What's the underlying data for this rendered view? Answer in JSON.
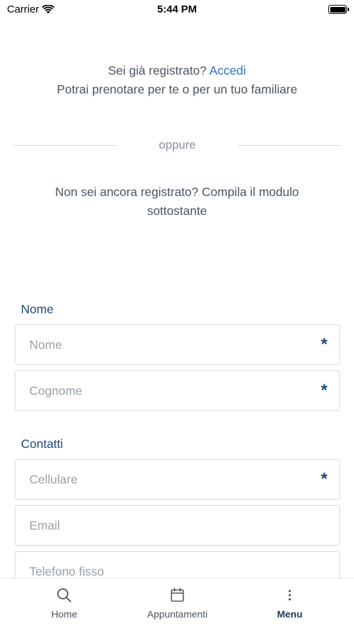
{
  "status_bar": {
    "carrier": "Carrier",
    "time": "5:44 PM"
  },
  "intro": {
    "already_registered": "Sei già registrato?",
    "login_link": "Accedi",
    "subtitle": "Potrai prenotare per te o per un tuo familiare"
  },
  "divider": {
    "text": "oppure"
  },
  "register_prompt": "Non sei ancora registrato? Compila il modulo sottostante",
  "form": {
    "name_section": {
      "title": "Nome",
      "fields": [
        {
          "placeholder": "Nome",
          "required": "*"
        },
        {
          "placeholder": "Cognome",
          "required": "*"
        }
      ]
    },
    "contacts_section": {
      "title": "Contatti",
      "fields": [
        {
          "placeholder": "Cellulare",
          "required": "*"
        },
        {
          "placeholder": "Email"
        },
        {
          "placeholder": "Telefono fisso"
        }
      ]
    }
  },
  "tab_bar": {
    "items": [
      {
        "label": "Home",
        "icon": "search-icon"
      },
      {
        "label": "Appuntamenti",
        "icon": "calendar-icon"
      },
      {
        "label": "Menu",
        "icon": "more-vertical-icon",
        "active": true
      }
    ]
  },
  "colors": {
    "accent": "#2b72c4",
    "section_title": "#1e4a7a",
    "text": "#4a5560",
    "placeholder": "#9aa0a6"
  }
}
